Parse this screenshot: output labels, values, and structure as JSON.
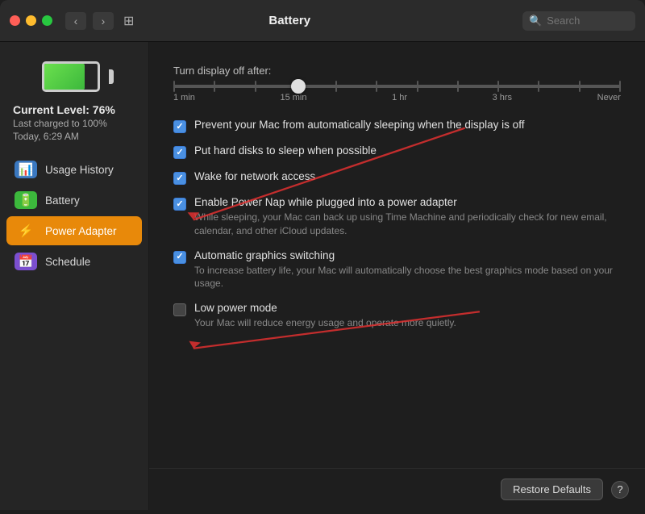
{
  "titlebar": {
    "title": "Battery",
    "search_placeholder": "Search",
    "back_label": "‹",
    "forward_label": "›",
    "grid_icon": "⊞"
  },
  "sidebar": {
    "battery_level": "Current Level: 76%",
    "battery_charged": "Last charged to 100%",
    "battery_time": "Today, 6:29 AM",
    "items": [
      {
        "id": "usage-history",
        "label": "Usage History",
        "icon": "📊",
        "active": false
      },
      {
        "id": "battery",
        "label": "Battery",
        "icon": "🔋",
        "active": false
      },
      {
        "id": "power-adapter",
        "label": "Power Adapter",
        "icon": "⚡",
        "active": true
      },
      {
        "id": "schedule",
        "label": "Schedule",
        "icon": "📅",
        "active": false
      }
    ]
  },
  "content": {
    "slider_label": "Turn display off after:",
    "slider_labels": [
      "1 min",
      "15 min",
      "1 hr",
      "3 hrs",
      "Never"
    ],
    "slider_value": 28,
    "options": [
      {
        "id": "prevent-sleep",
        "title": "Prevent your Mac from automatically sleeping when the display is off",
        "description": "",
        "checked": true
      },
      {
        "id": "hard-disk-sleep",
        "title": "Put hard disks to sleep when possible",
        "description": "",
        "checked": true
      },
      {
        "id": "wake-network",
        "title": "Wake for network access",
        "description": "",
        "checked": true
      },
      {
        "id": "power-nap",
        "title": "Enable Power Nap while plugged into a power adapter",
        "description": "While sleeping, your Mac can back up using Time Machine and periodically check for new email, calendar, and other iCloud updates.",
        "checked": true
      },
      {
        "id": "auto-graphics",
        "title": "Automatic graphics switching",
        "description": "To increase battery life, your Mac will automatically choose the best graphics mode based on your usage.",
        "checked": true
      },
      {
        "id": "low-power",
        "title": "Low power mode",
        "description": "Your Mac will reduce energy usage and operate more quietly.",
        "checked": false
      }
    ],
    "restore_defaults": "Restore Defaults",
    "help_label": "?"
  }
}
